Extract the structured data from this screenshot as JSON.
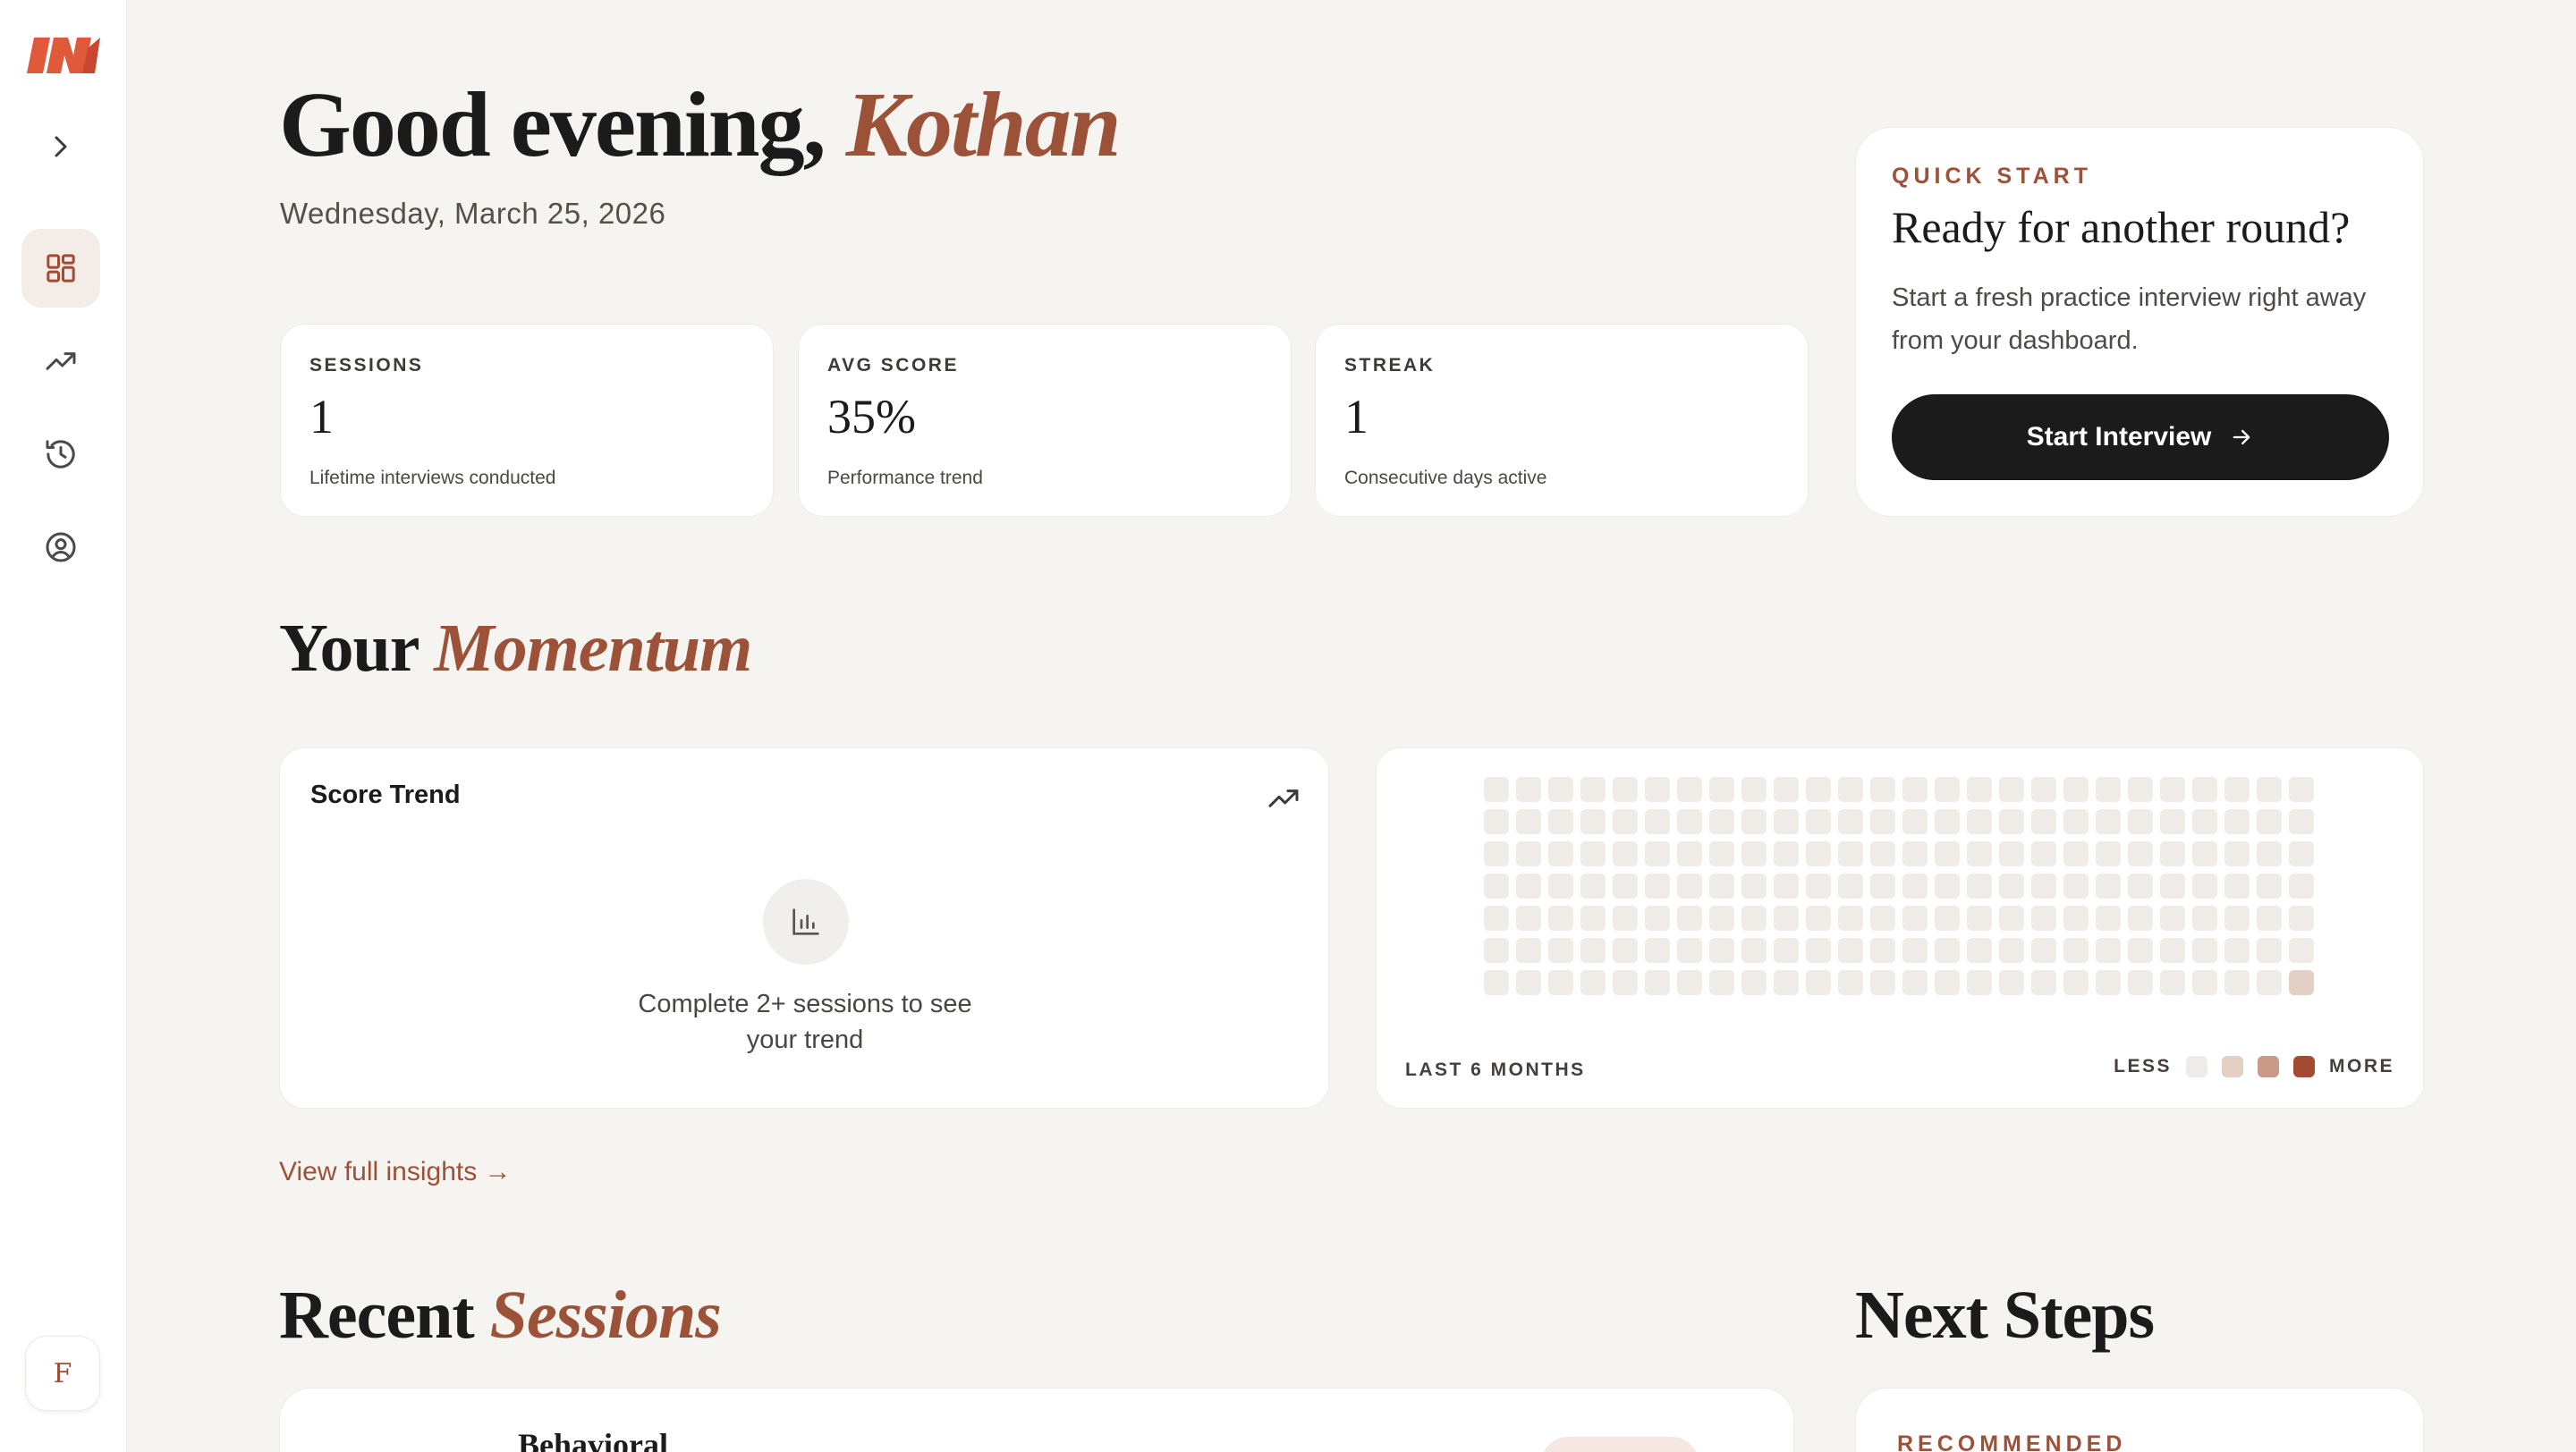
{
  "greeting": {
    "prefix": "Good evening,",
    "name": "Kothan"
  },
  "date": "Wednesday, March 25, 2026",
  "stats": [
    {
      "label": "SESSIONS",
      "value": "1",
      "sub": "Lifetime interviews conducted"
    },
    {
      "label": "AVG SCORE",
      "value": "35%",
      "sub": "Performance trend"
    },
    {
      "label": "STREAK",
      "value": "1",
      "sub": "Consecutive days active"
    }
  ],
  "quick_start": {
    "eyebrow": "QUICK START",
    "title": "Ready for another round?",
    "description": "Start a fresh practice interview right away from your dashboard.",
    "button_label": "Start Interview"
  },
  "momentum": {
    "prefix": "Your",
    "accent": "Momentum"
  },
  "score_trend": {
    "title": "Score Trend",
    "empty_text": "Complete 2+ sessions to see your trend"
  },
  "activity": {
    "range_label": "LAST 6 MONTHS",
    "less_label": "LESS",
    "more_label": "MORE",
    "weeks": 26,
    "days_per_week": 7,
    "active_cells": [
      {
        "week": 25,
        "day": 6,
        "level": 1
      }
    ],
    "legend_colors": [
      "#efece8",
      "#e4cfc4",
      "#c99a88",
      "#a44a33"
    ]
  },
  "insights_link": "View full insights →",
  "recent": {
    "prefix": "Recent",
    "accent": "Sessions"
  },
  "next_steps": {
    "title": "Next Steps",
    "eyebrow": "RECOMMENDED"
  },
  "session_preview": {
    "title": "Behavioral"
  },
  "user": {
    "initial": "F"
  },
  "colors": {
    "accent": "#9c5238",
    "background": "#f6f4f1",
    "button": "#1c1b1b"
  }
}
